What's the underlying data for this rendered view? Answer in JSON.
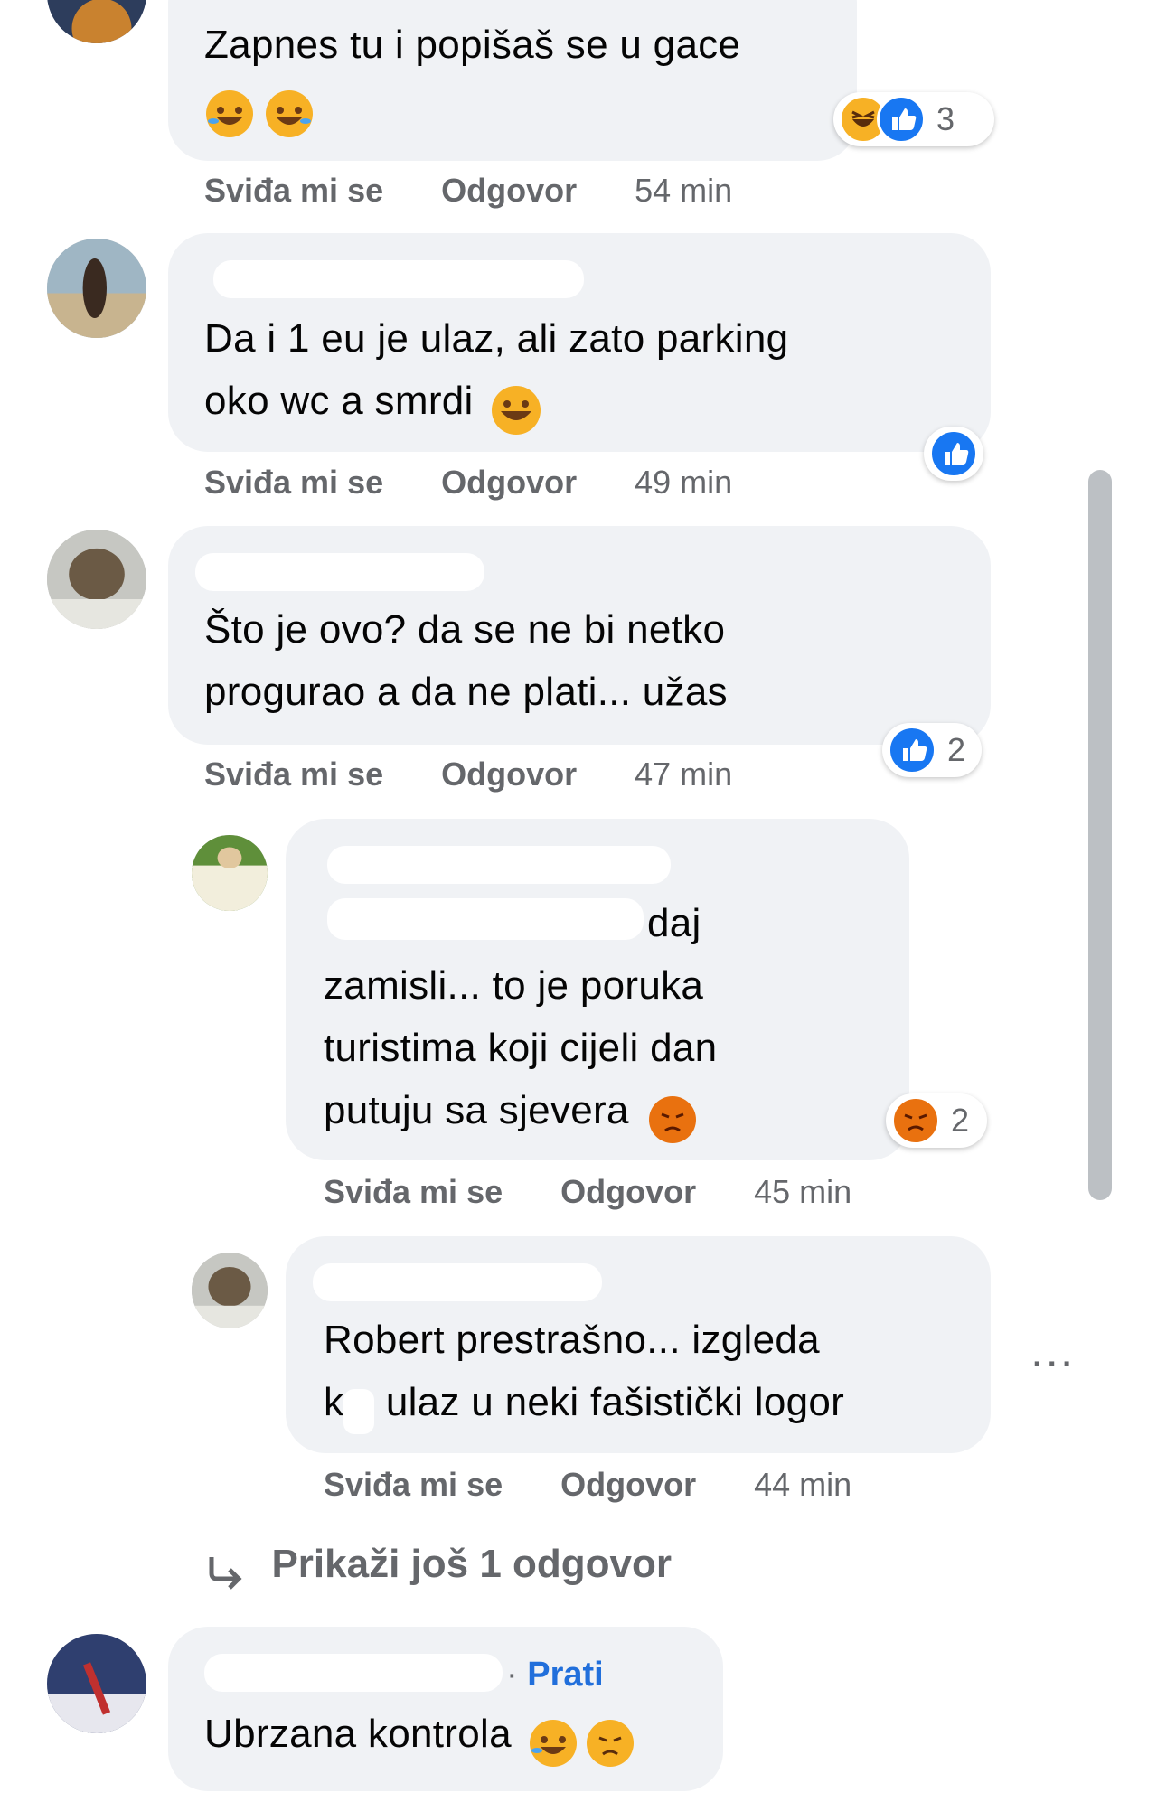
{
  "actions": {
    "like_label": "Sviđa mi se",
    "reply_label": "Odgovor"
  },
  "comments": [
    {
      "text_lines": [
        "Zapnes tu i popišaš se u gace"
      ],
      "time": "54 min",
      "reaction_count": "3",
      "reactions": [
        "haha",
        "like"
      ]
    },
    {
      "text_lines": [
        "Da i 1 eu je ulaz, ali zato parking",
        "oko wc a smrdi"
      ],
      "time": "49 min",
      "reaction_count": "",
      "reactions": [
        "like"
      ]
    },
    {
      "text_lines": [
        "Što je ovo? da se ne bi netko",
        "progurao a da ne plati... užas"
      ],
      "time": "47 min",
      "reaction_count": "2",
      "reactions": [
        "like"
      ]
    },
    {
      "text_lines": [
        "daj",
        "zamisli... to je poruka",
        "turistima koji cijeli dan",
        "putuju sa sjevera"
      ],
      "time": "45 min",
      "reaction_count": "2",
      "reactions": [
        "angry"
      ]
    },
    {
      "text_lines": [
        "Robert prestrašno... izgleda",
        "k",
        " ulaz u neki fašistički logor"
      ],
      "time": "44 min",
      "reaction_count": "",
      "reactions": []
    },
    {
      "follow_label": "Prati",
      "text_lines": [
        "Ubrzana kontrola"
      ]
    }
  ],
  "view_more_replies": "Prikaži još 1 odgovor",
  "more_menu_label": "...",
  "colors": {
    "bubble": "#f0f2f5",
    "meta_text": "#65676b",
    "link_blue": "#216fdb",
    "like_blue": "#1877f2",
    "haha_yellow": "#f7b125",
    "angry_orange": "#e9710f"
  }
}
